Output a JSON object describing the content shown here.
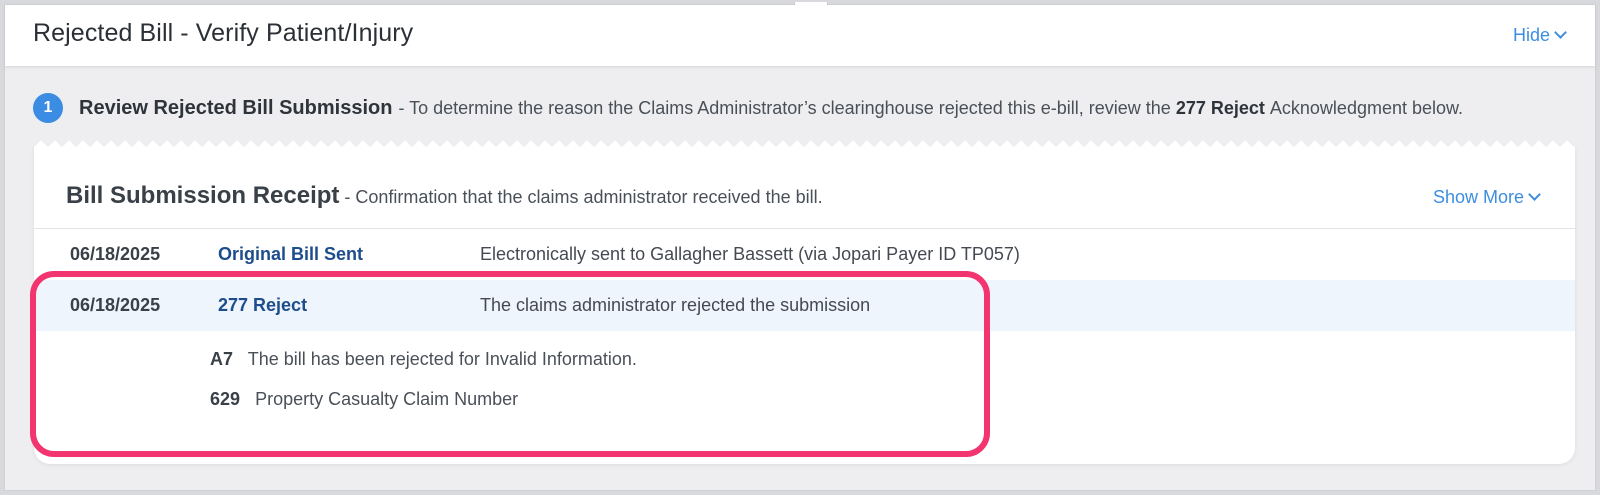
{
  "header": {
    "title": "Rejected Bill - Verify Patient/Injury",
    "hide_label": "Hide"
  },
  "step": {
    "number": "1",
    "title": "Review Rejected Bill Submission",
    "text_before": "- To determine the reason the Claims Administrator’s clearinghouse rejected this e-bill, review the",
    "bold_term": "277 Reject",
    "text_after": "Acknowledgment below."
  },
  "receipt": {
    "title": "Bill Submission Receipt",
    "subtitle": "- Confirmation that the claims administrator received the bill.",
    "show_more_label": "Show More",
    "rows": [
      {
        "date": "06/18/2025",
        "event": "Original Bill Sent",
        "description": "Electronically sent to Gallagher Bassett (via Jopari Payer ID TP057)"
      },
      {
        "date": "06/18/2025",
        "event": "277 Reject",
        "description": "The claims administrator rejected the submission"
      }
    ],
    "reasons": [
      {
        "code": "A7",
        "text": "The bill has been rejected for Invalid Information."
      },
      {
        "code": "629",
        "text": "Property Casualty Claim Number"
      }
    ]
  },
  "colors": {
    "accent": "#3d8ee0",
    "link_dark": "#1d4d8c",
    "highlight_border": "#f2346f",
    "selected_row": "#eef5fc"
  }
}
